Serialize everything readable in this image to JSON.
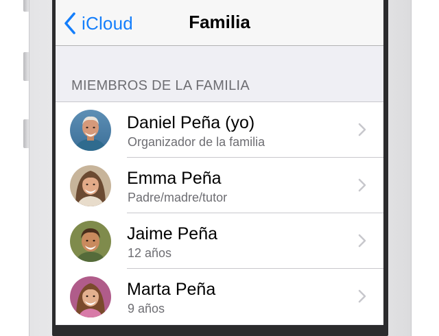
{
  "nav": {
    "back_label": "iCloud",
    "title": "Familia",
    "accent_color": "#147efb"
  },
  "section": {
    "header": "MIEMBROS DE LA FAMILIA"
  },
  "members": [
    {
      "name": "Daniel Peña (yo)",
      "role": "Organizador de la familia",
      "avatar_icon": "man-photo"
    },
    {
      "name": "Emma Peña",
      "role": "Padre/madre/tutor",
      "avatar_icon": "woman-photo"
    },
    {
      "name": "Jaime Peña",
      "role": "12 años",
      "avatar_icon": "boy-photo"
    },
    {
      "name": "Marta Peña",
      "role": "9 años",
      "avatar_icon": "girl-photo"
    }
  ],
  "icons": {
    "back": "chevron-left-icon",
    "row_disclosure": "chevron-right-icon"
  }
}
